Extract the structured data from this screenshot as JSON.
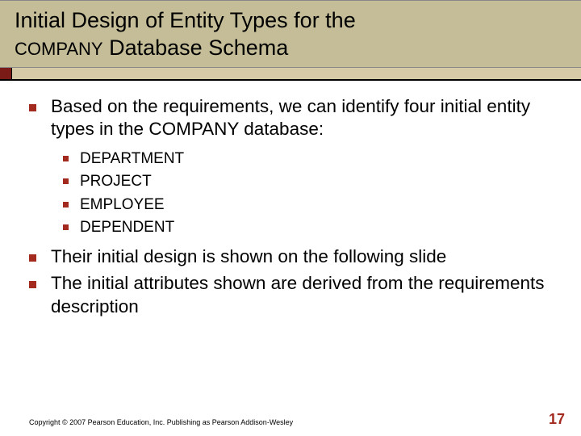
{
  "header": {
    "line1": "Initial Design of Entity Types for the",
    "company": "COMPANY",
    "line2_rest": " Database Schema"
  },
  "bullets": {
    "b1": "Based on the requirements, we can identify four initial entity types in the COMPANY database:",
    "sub": {
      "s1": "DEPARTMENT",
      "s2": "PROJECT",
      "s3": "EMPLOYEE",
      "s4": "DEPENDENT"
    },
    "b2": "Their initial design is shown on the following slide",
    "b3": "The initial attributes shown are derived from the requirements description"
  },
  "footer": {
    "copyright": "Copyright © 2007 Pearson Education, Inc. Publishing as Pearson Addison-Wesley",
    "page": "17"
  }
}
